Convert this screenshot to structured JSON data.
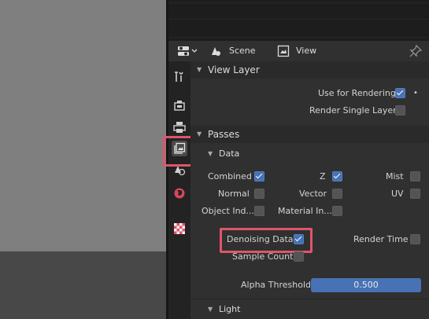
{
  "header": {
    "scene_label": "Scene",
    "view_layer_label": "View Layer"
  },
  "sidebar": {
    "tabs": [
      "tool",
      "render",
      "output",
      "view-layer",
      "scene",
      "world",
      "texture"
    ],
    "active_tab": "view-layer"
  },
  "sections": {
    "view_layer": {
      "title": "View Layer",
      "use_for_rendering": {
        "label": "Use for Rendering",
        "checked": true
      },
      "render_single_layer": {
        "label": "Render Single Layer",
        "checked": false
      }
    },
    "passes": {
      "title": "Passes",
      "data": {
        "title": "Data",
        "combined": {
          "label": "Combined",
          "checked": true
        },
        "z": {
          "label": "Z",
          "checked": true
        },
        "mist": {
          "label": "Mist",
          "checked": false
        },
        "normal": {
          "label": "Normal",
          "checked": false
        },
        "vector": {
          "label": "Vector",
          "checked": false
        },
        "uv": {
          "label": "UV",
          "checked": false
        },
        "object_index": {
          "label": "Object Ind...",
          "checked": false
        },
        "material_index": {
          "label": "Material In...",
          "checked": false
        },
        "denoising_data": {
          "label": "Denoising Data",
          "checked": true
        },
        "render_time": {
          "label": "Render Time",
          "checked": false
        },
        "sample_count": {
          "label": "Sample Count",
          "checked": false
        },
        "alpha_threshold": {
          "label": "Alpha Threshold",
          "value": "0.500"
        }
      },
      "light": {
        "title": "Light"
      }
    }
  },
  "colors": {
    "accent": "#4772b3",
    "highlight": "#e0556b",
    "panel": "#303030"
  }
}
